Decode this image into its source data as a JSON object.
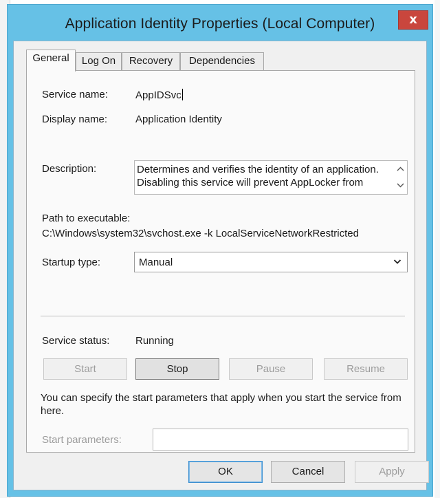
{
  "window": {
    "title": "Application Identity Properties (Local Computer)",
    "close_glyph": "x"
  },
  "tabs": [
    {
      "label": "General",
      "active": true
    },
    {
      "label": "Log On",
      "active": false
    },
    {
      "label": "Recovery",
      "active": false
    },
    {
      "label": "Dependencies",
      "active": false
    }
  ],
  "general": {
    "service_name_label": "Service name:",
    "service_name": "AppIDSvc",
    "display_name_label": "Display name:",
    "display_name": "Application Identity",
    "description_label": "Description:",
    "description_lines": [
      "Determines and verifies the identity of an application.",
      "Disabling this service will prevent AppLocker from"
    ],
    "path_label": "Path to executable:",
    "path": "C:\\Windows\\system32\\svchost.exe -k LocalServiceNetworkRestricted",
    "startup_type_label": "Startup type:",
    "startup_type": "Manual",
    "service_status_label": "Service status:",
    "service_status": "Running",
    "buttons": {
      "start": "Start",
      "stop": "Stop",
      "pause": "Pause",
      "resume": "Resume"
    },
    "start_params_note": "You can specify the start parameters that apply when you start the service from here.",
    "start_params_label": "Start parameters:",
    "start_params_value": ""
  },
  "footer": {
    "ok": "OK",
    "cancel": "Cancel",
    "apply": "Apply"
  },
  "colors": {
    "title_bar": "#66c1e6",
    "close_button": "#c9463d"
  },
  "icons": {
    "close": "close-icon",
    "scroll_up": "chevron-up-icon",
    "scroll_down": "chevron-down-icon",
    "dropdown": "chevron-down-icon"
  }
}
